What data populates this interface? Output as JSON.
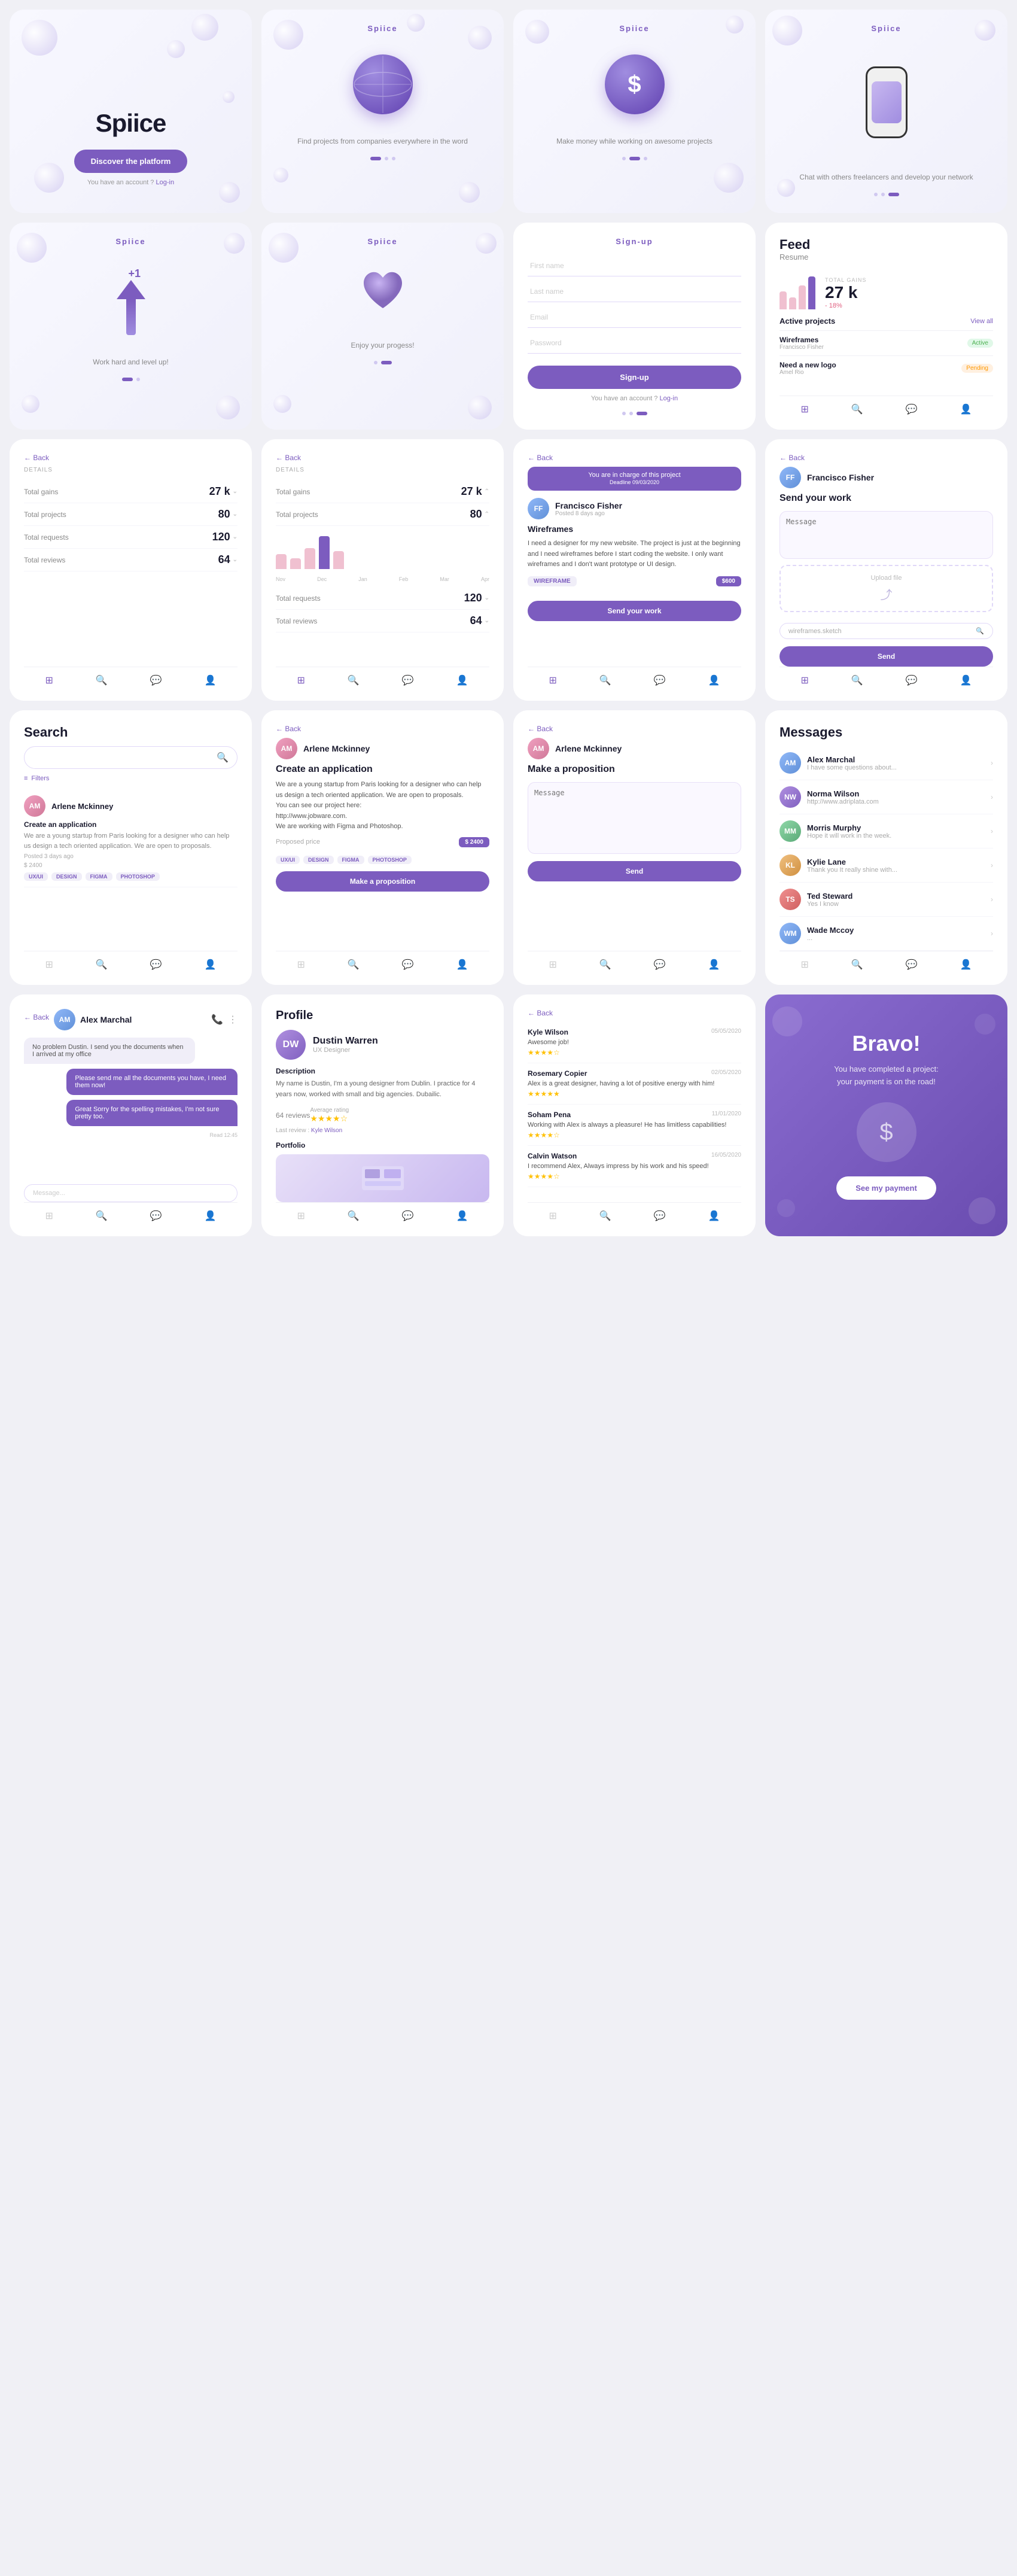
{
  "app": {
    "name": "Spiice",
    "tagline": "Discover the platform",
    "account_text": "You have an account ?",
    "login_text": "Log-in"
  },
  "onboarding": [
    {
      "title": "Spiice",
      "desc": "Find projects from companies everywhere in the word",
      "active_dot": 0
    },
    {
      "title": "Spiice",
      "desc": "Make money while working on awesome projects",
      "active_dot": 1
    },
    {
      "title": "Spiice",
      "desc": "Chat with others freelancers and develop your network",
      "active_dot": 2
    },
    {
      "title": "Spiice",
      "desc": "Work hard and level up!",
      "active_dot": 0
    },
    {
      "title": "Spiice",
      "desc": "Enjoy your progess!",
      "active_dot": 1
    }
  ],
  "signup": {
    "title": "Sign-up",
    "fields": [
      "First name",
      "Last name",
      "Email",
      "Password"
    ],
    "button": "Sign-up",
    "account_text": "You have an account ?",
    "login_text": "Log-in"
  },
  "feed": {
    "title": "Feed",
    "subtitle": "Resume",
    "total_gains_label": "TOTAL GAINS",
    "total_gains_value": "27 k",
    "total_gains_pct": "- 18%",
    "active_projects_title": "Active projects",
    "view_all": "View all",
    "projects": [
      {
        "name": "Wireframes",
        "author": "Francisco Fisher",
        "status": "Active"
      },
      {
        "name": "Need a new logo",
        "author": "Amel Rio",
        "status": "Pending"
      }
    ]
  },
  "details": {
    "back": "Back",
    "label": "DETAILS",
    "stats": [
      {
        "label": "Total gains",
        "value": "27 k"
      },
      {
        "label": "Total projects",
        "value": "80"
      },
      {
        "label": "Total requests",
        "value": "120"
      },
      {
        "label": "Total reviews",
        "value": "64"
      }
    ]
  },
  "project_detail": {
    "back": "Back",
    "banner": "You are in charge of this project\nDeadline 09/03/2020",
    "freelancer": "Francisco Fisher",
    "posted": "Posted 8 days ago",
    "project_title": "Wireframes",
    "description": "I need a designer for my new website. The project is just at the beginning and I need wireframes before I start coding the website. I only want wireframes and I don't want prototype or UI design.",
    "tag": "WIREFRAME",
    "price": "$600",
    "send_btn": "Send your work"
  },
  "send_work": {
    "back": "Back",
    "freelancer": "Francisco Fisher",
    "title": "Send your work",
    "message_placeholder": "Message",
    "upload_label": "Upload file",
    "file_name": "wireframes.sketch",
    "send_btn": "Send"
  },
  "search": {
    "title": "Search",
    "placeholder": "",
    "filter": "Filters",
    "results": [
      {
        "name": "Arlene Mckinney",
        "project": "Create an application",
        "desc": "We are a young startup from Paris looking for a designer who can help us design a tech oriented application. We are open to proposals.",
        "posted": "Posted 3 days ago",
        "price": "$ 2400",
        "tags": [
          "UX/UI",
          "DESIGN",
          "FIGMA",
          "PHOTOSHOP"
        ]
      }
    ]
  },
  "proposition": {
    "back": "Back",
    "name": "Arlene Mckinney",
    "project": "Create an application",
    "desc": "We are a young startup from Paris looking for a designer who can help us design a tech oriented application. We are open to proposals.\nYou can see our project here:\nhttp://www.jobware.com.\nWe are working with Figma and Photoshop.",
    "price_label": "Proposed price",
    "price": "$ 2400",
    "tags": [
      "UX/UI",
      "DESIGN",
      "FIGMA",
      "PHOTOSHOP"
    ],
    "btn": "Make a proposition"
  },
  "proposition_send": {
    "back": "Back",
    "name": "Arlene Mckinney",
    "project": "Make a proposition",
    "message_placeholder": "Message",
    "send_btn": "Send"
  },
  "messages": {
    "title": "Messages",
    "items": [
      {
        "name": "Alex Marchal",
        "preview": "I have some questions about..."
      },
      {
        "name": "Norma Wilson",
        "preview": "http://www.adriplata.com"
      },
      {
        "name": "Morris Murphy",
        "preview": "Hope it will work in the week."
      },
      {
        "name": "Kylie Lane",
        "preview": "Thank you It really shine with..."
      },
      {
        "name": "Ted Steward",
        "preview": "Yes I know"
      },
      {
        "name": "Wade Mccoy",
        "preview": "..."
      }
    ]
  },
  "chat": {
    "back": "Back",
    "name": "Alex Marchal",
    "messages": [
      {
        "text": "No problem Dustin. I send you the documents when I arrived at my office",
        "from": "them"
      },
      {
        "text": "Please send me all the documents you have, I need them now!",
        "from": "me"
      },
      {
        "text": "Great Sorry for the spelling mistakes, I'm not sure pretty too.",
        "from": "them"
      }
    ],
    "time": "Read 12:45"
  },
  "profile": {
    "title": "Profile",
    "name": "Dustin Warren",
    "role": "UX Designer",
    "description": "My name is Dustin, I'm a young designer from Dublin. I practice for 4 years now, worked with small and big agencies. Dubailic.",
    "reviews_count": "64 reviews",
    "avg_rating": "Average rating",
    "last_review_label": "Last review :",
    "last_review_name": "Kyle Wilson",
    "portfolio_label": "Portfolio"
  },
  "reviews": {
    "back": "Back",
    "items": [
      {
        "name": "Kyle Wilson",
        "date": "05/05/2020",
        "title": "Awesome job!",
        "stars": 4,
        "text": ""
      },
      {
        "name": "Rosemary Copier",
        "date": "02/05/2020",
        "title": "Alex is a great designer, having a lot of positive energy with him!",
        "stars": 5,
        "text": ""
      },
      {
        "name": "Soham Pena",
        "date": "11/01/2020",
        "title": "Working with Alex is always a pleasure! He has limitless capabilities!",
        "stars": 4,
        "text": ""
      },
      {
        "name": "Calvin Watson",
        "date": "16/05/2020",
        "title": "I recommend Alex, Always impress by his work and his speed!",
        "stars": 4,
        "text": ""
      }
    ]
  },
  "bravo": {
    "title": "Bravo!",
    "desc": "You have completed a project:\nyour payment is on the road!",
    "btn": "See my payment"
  }
}
